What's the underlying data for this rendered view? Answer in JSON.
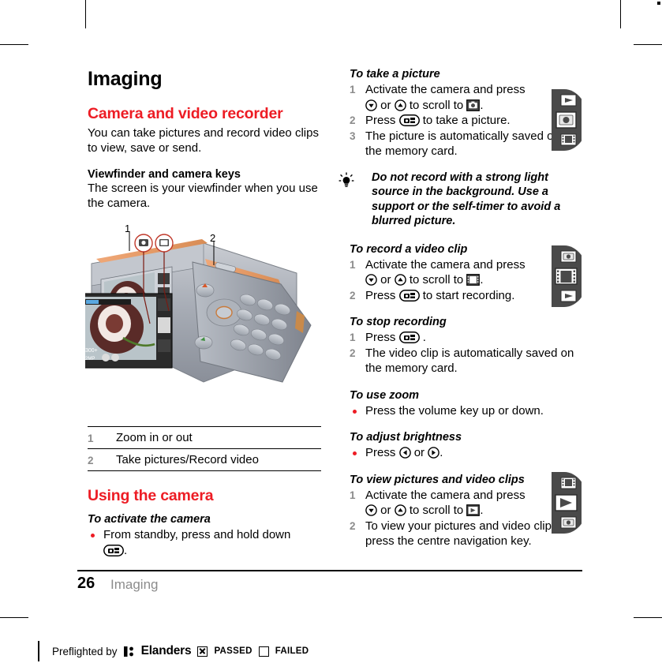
{
  "document": {
    "page_title": "Imaging",
    "folio_number": "26",
    "folio_label": "Imaging"
  },
  "left_column": {
    "section_heading": "Camera and video recorder",
    "intro_paragraph": "You can take pictures and record video clips to view, save or send.",
    "subsection_heading": "Viewfinder and camera keys",
    "subsection_paragraph": "The screen is your viewfinder when you use the camera.",
    "illustration": {
      "callout_1": "1",
      "callout_2": "2",
      "viewfinder_zoom_label": "300+",
      "viewfinder_res_label": "2MP"
    },
    "legend_table": {
      "rows": [
        {
          "num": "1",
          "label": "Zoom in or out"
        },
        {
          "num": "2",
          "label": "Take pictures/Record video"
        }
      ]
    },
    "using_heading": "Using the camera",
    "activate": {
      "heading": "To activate the camera",
      "step_a": "From standby, press and hold down",
      "step_b": "."
    }
  },
  "right_column": {
    "take_picture": {
      "heading": "To take a picture",
      "steps": [
        {
          "num": "1",
          "a": "Activate the camera and press",
          "b": "or",
          "c": "to scroll to",
          "d": "."
        },
        {
          "num": "2",
          "a": "Press",
          "b": "to take a picture."
        },
        {
          "num": "3",
          "a": "The picture is automatically saved on the memory card."
        }
      ]
    },
    "tip": {
      "text": "Do not record with a strong light source in the background. Use a support or the self-timer to avoid a blurred picture."
    },
    "record_video": {
      "heading": "To record a video clip",
      "steps": [
        {
          "num": "1",
          "a": "Activate the camera and press",
          "b": "or",
          "c": "to scroll to",
          "d": "."
        },
        {
          "num": "2",
          "a": "Press",
          "b": "to start recording."
        }
      ]
    },
    "stop_recording": {
      "heading": "To stop recording",
      "steps": [
        {
          "num": "1",
          "a": "Press",
          "b": "."
        },
        {
          "num": "2",
          "a": "The video clip is automatically saved on the memory card."
        }
      ]
    },
    "use_zoom": {
      "heading": "To use zoom",
      "bullet": "Press the volume key up or down."
    },
    "adjust_brightness": {
      "heading": "To adjust brightness",
      "bullet_a": "Press",
      "bullet_b": "or",
      "bullet_c": "."
    },
    "view_pictures": {
      "heading": "To view pictures and video clips",
      "steps": [
        {
          "num": "1",
          "a": "Activate the camera and press",
          "b": "or",
          "c": "to scroll to",
          "d": "."
        },
        {
          "num": "2",
          "a": "To view your pictures and video clips, press the centre navigation key."
        }
      ]
    }
  },
  "preflight": {
    "text": "Preflighted by",
    "brand": "Elanders",
    "passed_label": "PASSED",
    "failed_label": "FAILED"
  },
  "icons": {
    "nav_down": "nav-down-key-icon",
    "nav_up": "nav-up-key-icon",
    "nav_left": "nav-left-key-icon",
    "nav_right": "nav-right-key-icon",
    "camera_key": "camera-key-icon",
    "camera_mode": "camera-mode-icon",
    "video_mode": "video-mode-icon",
    "play_mode": "play-mode-icon",
    "tip_bulb": "lightbulb-tip-icon"
  },
  "colors": {
    "accent_red": "#ed1c24",
    "numeral_gray": "#8c8c8c",
    "leader_line": "#7a1a12"
  }
}
